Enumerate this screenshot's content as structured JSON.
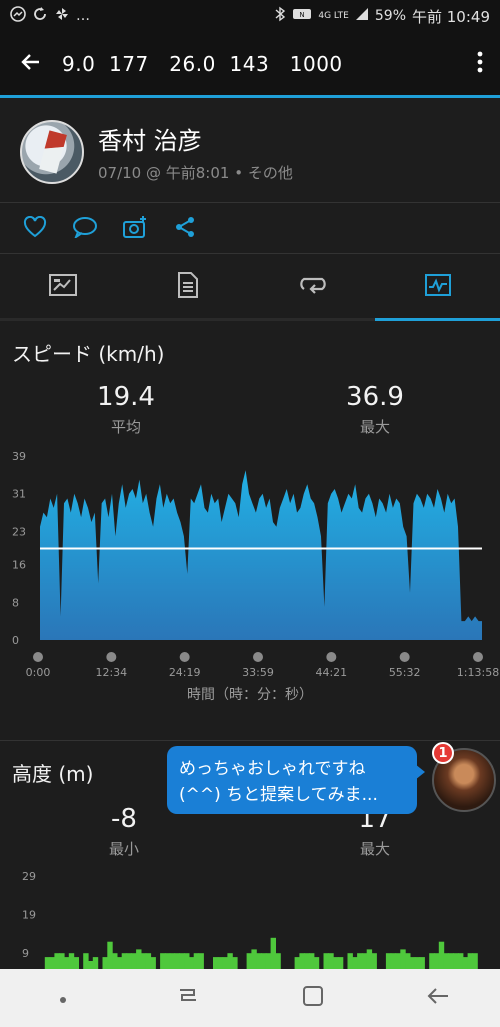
{
  "status_bar": {
    "left_icons": [
      "messenger-icon",
      "sync-icon",
      "pinwheel-icon",
      "more-dots-icon"
    ],
    "battery": "59%",
    "time": "午前 10:49",
    "signal": "4G LTE"
  },
  "app_bar": {
    "title": "9.0  177   26.0  143   1000"
  },
  "profile": {
    "name": "香村 治彦",
    "meta": "07/10 @ 午前8:01 • その他"
  },
  "speed": {
    "title": "スピード (km/h)",
    "avg_value": "19.4",
    "avg_label": "平均",
    "max_value": "36.9",
    "max_label": "最大",
    "x_axis_title": "時間（時：分：秒）",
    "colors": {
      "fill": "#1fa0d8",
      "avg_line": "#ffffff"
    }
  },
  "altitude": {
    "title": "高度 (m)",
    "min_value": "-8",
    "min_label": "最小",
    "max_value": "17",
    "max_label": "最大",
    "colors": {
      "fill": "#4fc83c"
    }
  },
  "chat_bubble": {
    "text": "めっちゃおしゃれですね (^^) ちと提案してみま...",
    "badge": "1"
  },
  "chart_data": [
    {
      "type": "area",
      "title": "スピード (km/h)",
      "xlabel": "時間（時：分：秒）",
      "ylabel": "",
      "x_ticks": [
        "0:00",
        "12:34",
        "24:19",
        "33:59",
        "44:21",
        "55:32",
        "1:13:58"
      ],
      "y_ticks": [
        0,
        8,
        16,
        23,
        31,
        39
      ],
      "ylim": [
        0,
        39
      ],
      "avg_line": 19.4,
      "series": [
        {
          "values": [
            24,
            27,
            26,
            30,
            28,
            31,
            5,
            29,
            30,
            27,
            31,
            29,
            26,
            30,
            28,
            25,
            27,
            12,
            29,
            30,
            26,
            31,
            22,
            29,
            33,
            28,
            31,
            32,
            30,
            34,
            29,
            31,
            27,
            24,
            30,
            33,
            28,
            31,
            29,
            30,
            27,
            25,
            22,
            14,
            30,
            29,
            31,
            33,
            28,
            27,
            31,
            29,
            30,
            25,
            28,
            31,
            30,
            29,
            26,
            33,
            36,
            31,
            29,
            27,
            30,
            31,
            28,
            30,
            25,
            24,
            28,
            30,
            32,
            29,
            31,
            27,
            28,
            31,
            33,
            30,
            29,
            26,
            22,
            7,
            29,
            31,
            32,
            30,
            27,
            29,
            31,
            30,
            33,
            28,
            27,
            30,
            31,
            29,
            26,
            30,
            29,
            27,
            31,
            28,
            30,
            29,
            24,
            22,
            10,
            29,
            31,
            30,
            28,
            31,
            30,
            28,
            32,
            30,
            27,
            31,
            29,
            30,
            24,
            4,
            4,
            5,
            4,
            5,
            4,
            4
          ]
        }
      ]
    },
    {
      "type": "area",
      "title": "高度 (m)",
      "y_ticks": [
        9,
        19,
        29
      ],
      "ylim": [
        0,
        29
      ],
      "series": [
        {
          "values": [
            0,
            8,
            8,
            9,
            9,
            8,
            9,
            8,
            0,
            9,
            7,
            8,
            0,
            8,
            12,
            9,
            8,
            9,
            9,
            9,
            10,
            9,
            9,
            8,
            0,
            9,
            9,
            9,
            9,
            9,
            9,
            8,
            9,
            9,
            0,
            0,
            8,
            8,
            8,
            9,
            8,
            0,
            0,
            9,
            10,
            9,
            9,
            9,
            13,
            9,
            0,
            0,
            0,
            8,
            9,
            9,
            9,
            8,
            0,
            9,
            9,
            8,
            8,
            0,
            9,
            8,
            9,
            9,
            10,
            9,
            0,
            0,
            9,
            9,
            9,
            10,
            9,
            8,
            8,
            8,
            0,
            9,
            9,
            12,
            9,
            9,
            9,
            9,
            8,
            9,
            9,
            0
          ]
        }
      ]
    }
  ]
}
